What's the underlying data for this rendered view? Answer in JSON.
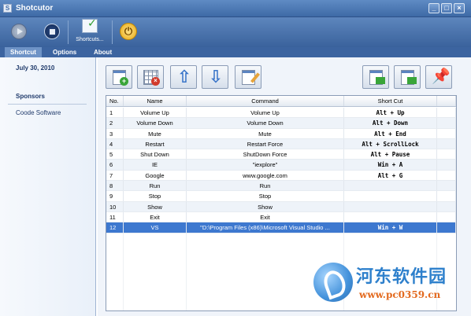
{
  "window": {
    "title": "Shotcutor",
    "min_glyph": "_",
    "max_glyph": "□",
    "close_glyph": "×"
  },
  "toolbar": {
    "shortcuts_label": "Shortcuts...",
    "power_glyph": "⏻"
  },
  "tabs": [
    {
      "label": "Shortcut",
      "active": true
    },
    {
      "label": "Options",
      "active": false
    },
    {
      "label": "About",
      "active": false
    }
  ],
  "sidebar": {
    "date": "July 30, 2010",
    "sponsors_heading": "Sponsors",
    "sponsor_link": "Coode Software"
  },
  "actions": {
    "up_glyph": "⇧",
    "down_glyph": "⇩",
    "add_glyph": "+",
    "delete_glyph": "×",
    "pin_glyph": "📌"
  },
  "table": {
    "headers": [
      "No.",
      "Name",
      "Command",
      "Short Cut"
    ],
    "rows": [
      {
        "no": "1",
        "name": "Volume Up",
        "command": "Volume Up",
        "shortcut": "Alt + Up"
      },
      {
        "no": "2",
        "name": "Volume Down",
        "command": "Volume Down",
        "shortcut": "Alt + Down"
      },
      {
        "no": "3",
        "name": "Mute",
        "command": "Mute",
        "shortcut": "Alt + End"
      },
      {
        "no": "4",
        "name": "Restart",
        "command": "Restart Force",
        "shortcut": "Alt + ScrollLock"
      },
      {
        "no": "5",
        "name": "Shut Down",
        "command": "ShutDown Force",
        "shortcut": "Alt + Pause"
      },
      {
        "no": "6",
        "name": "IE",
        "command": "\"iexplore\"",
        "shortcut": "Win + A"
      },
      {
        "no": "7",
        "name": "Google",
        "command": "www.google.com",
        "shortcut": "Alt + G"
      },
      {
        "no": "8",
        "name": "Run",
        "command": "Run",
        "shortcut": ""
      },
      {
        "no": "9",
        "name": "Stop",
        "command": "Stop",
        "shortcut": ""
      },
      {
        "no": "10",
        "name": "Show",
        "command": "Show",
        "shortcut": ""
      },
      {
        "no": "11",
        "name": "Exit",
        "command": "Exit",
        "shortcut": ""
      },
      {
        "no": "12",
        "name": "VS",
        "command": "\"D:\\Program Files (x86)\\Microsoft Visual Studio ...",
        "shortcut": "Win + W",
        "selected": true
      }
    ]
  },
  "watermark": {
    "text": "河东软件园",
    "url": "www.pc0359.cn"
  },
  "colors": {
    "titlebar": "#4f79b4",
    "selected_row": "#3d78cf",
    "sidebar_text": "#1f3a6b",
    "watermark_blue": "#2e80cc",
    "watermark_orange": "#e36a1f"
  }
}
